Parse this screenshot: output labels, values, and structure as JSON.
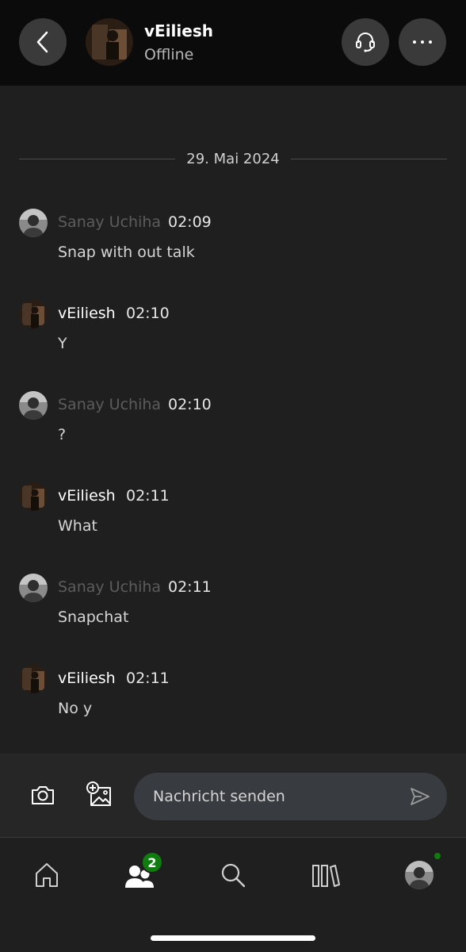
{
  "header": {
    "contact_name": "vEiliesh",
    "contact_status": "Offline"
  },
  "chat": {
    "date": "29. Mai 2024",
    "messages": [
      {
        "author": "Sanay Uchiha",
        "time": "02:09",
        "text": "Snap with out talk",
        "self": false
      },
      {
        "author": "vEiliesh",
        "time": "02:10",
        "text": "Y",
        "self": true
      },
      {
        "author": "Sanay Uchiha",
        "time": "02:10",
        "text": "?",
        "self": false
      },
      {
        "author": "vEiliesh",
        "time": "02:11",
        "text": "What",
        "self": true
      },
      {
        "author": "Sanay Uchiha",
        "time": "02:11",
        "text": "Snapchat",
        "self": false
      },
      {
        "author": "vEiliesh",
        "time": "02:11",
        "text": "No y",
        "self": true
      }
    ]
  },
  "composer": {
    "placeholder": "Nachricht senden",
    "icons": [
      "camera-icon",
      "add-image-icon",
      "send-icon"
    ]
  },
  "tabbar": {
    "tabs": [
      "home",
      "friends",
      "search",
      "library",
      "profile"
    ],
    "friends_badge": "2"
  },
  "colors": {
    "accent_green": "#107c10",
    "header_bg": "#0b0b0b",
    "chat_bg": "#1f1f1f",
    "input_bg": "#383b40"
  }
}
